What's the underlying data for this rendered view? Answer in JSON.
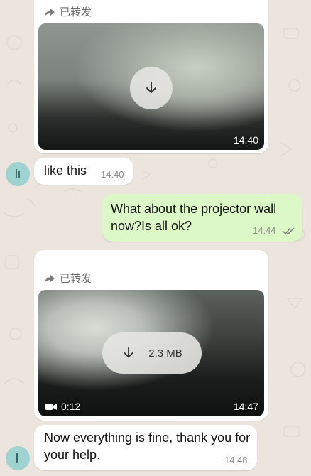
{
  "messages": {
    "m1": {
      "forwarded_label": "已转发",
      "time": "14:40"
    },
    "m2": {
      "text": "like this",
      "time": "14:40"
    },
    "m3": {
      "text": "What about the projector wall now?Is all ok?",
      "time": "14:44",
      "status": "read"
    },
    "m4": {
      "forwarded_label": "已转发",
      "size": "2.3 MB",
      "duration": "0:12",
      "time": "14:47"
    },
    "m5": {
      "text": "Now everything is fine, thank you for your help.",
      "time": "14:48"
    }
  },
  "colors": {
    "background": "#ECE5DD",
    "incoming_bubble": "#FFFFFF",
    "outgoing_bubble": "#DCF8C6",
    "read_tick": "#7a7a7a"
  },
  "icons": [
    "forward-icon",
    "download-icon",
    "video-icon",
    "double-check-icon",
    "avatar-icon"
  ]
}
